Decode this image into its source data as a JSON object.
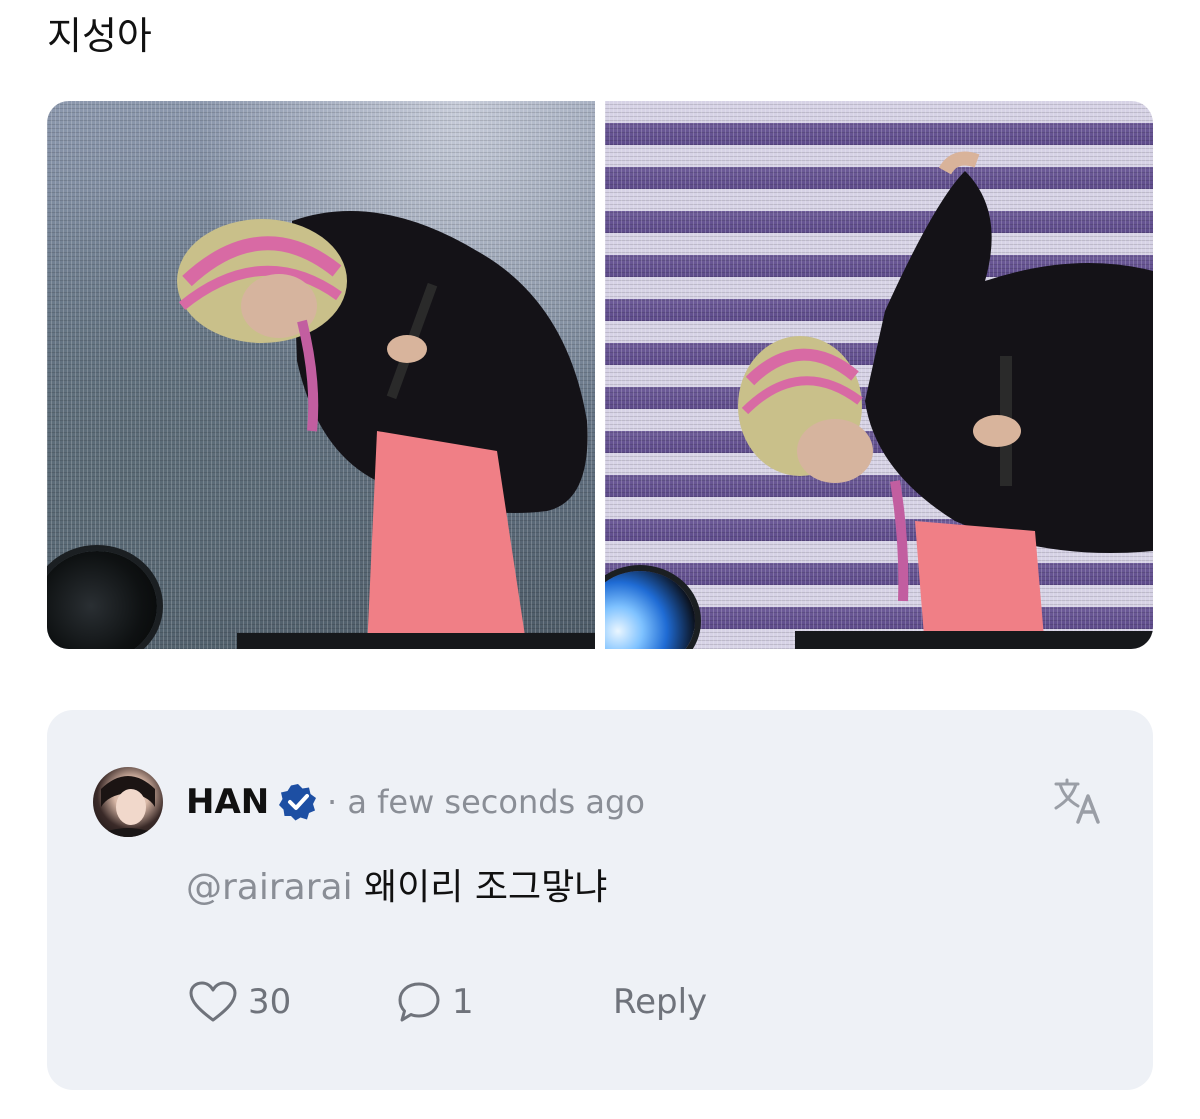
{
  "post": {
    "text": "지성아"
  },
  "comment": {
    "author": "HAN",
    "timestamp": "· a few seconds ago",
    "mention": "@rairarai",
    "body": "왜이리 조그맣냐",
    "likes": "30",
    "replies": "1",
    "reply_label": "Reply"
  },
  "icons": {
    "verified": "verified-badge-icon",
    "translate": "translate-icon",
    "like": "heart-icon",
    "reply": "speech-bubble-icon"
  },
  "colors": {
    "verified_badge": "#1d4fa3",
    "card_bg": "#eef1f6",
    "muted_text": "#8a8e96"
  }
}
